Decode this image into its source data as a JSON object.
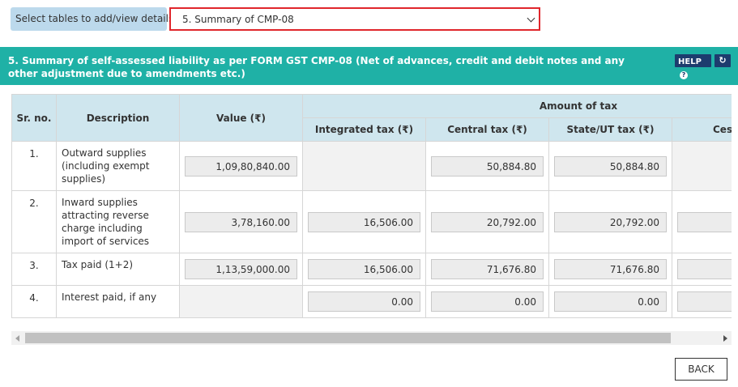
{
  "selector": {
    "label": "Select tables to add/view details",
    "selected": "5. Summary of CMP-08"
  },
  "section": {
    "title": "5. Summary of self-assessed liability as per FORM GST CMP-08 (Net of advances, credit and debit notes and any other adjustment due to amendments etc.)",
    "help_label": "HELP",
    "help_q": "?",
    "refresh_icon": "↻"
  },
  "table": {
    "headers": {
      "sr_no": "Sr. no.",
      "description": "Description",
      "value": "Value (₹)",
      "amount_of_tax": "Amount of tax",
      "integrated": "Integrated tax (₹)",
      "central": "Central tax (₹)",
      "state": "State/UT tax (₹)",
      "cess": "Cess"
    },
    "rows": [
      {
        "sr": "1.",
        "desc": "Outward supplies (including exempt supplies)",
        "value": "1,09,80,840.00",
        "integrated": "",
        "central": "50,884.80",
        "state": "50,884.80",
        "cess": ""
      },
      {
        "sr": "2.",
        "desc": "Inward supplies attracting reverse charge including import of services",
        "value": "3,78,160.00",
        "integrated": "16,506.00",
        "central": "20,792.00",
        "state": "20,792.00",
        "cess": ""
      },
      {
        "sr": "3.",
        "desc": "Tax paid (1+2)",
        "value": "1,13,59,000.00",
        "integrated": "16,506.00",
        "central": "71,676.80",
        "state": "71,676.80",
        "cess": ""
      },
      {
        "sr": "4.",
        "desc": "Interest paid, if any",
        "value": "",
        "integrated": "0.00",
        "central": "0.00",
        "state": "0.00",
        "cess": ""
      }
    ]
  },
  "footer": {
    "back_label": "BACK"
  }
}
